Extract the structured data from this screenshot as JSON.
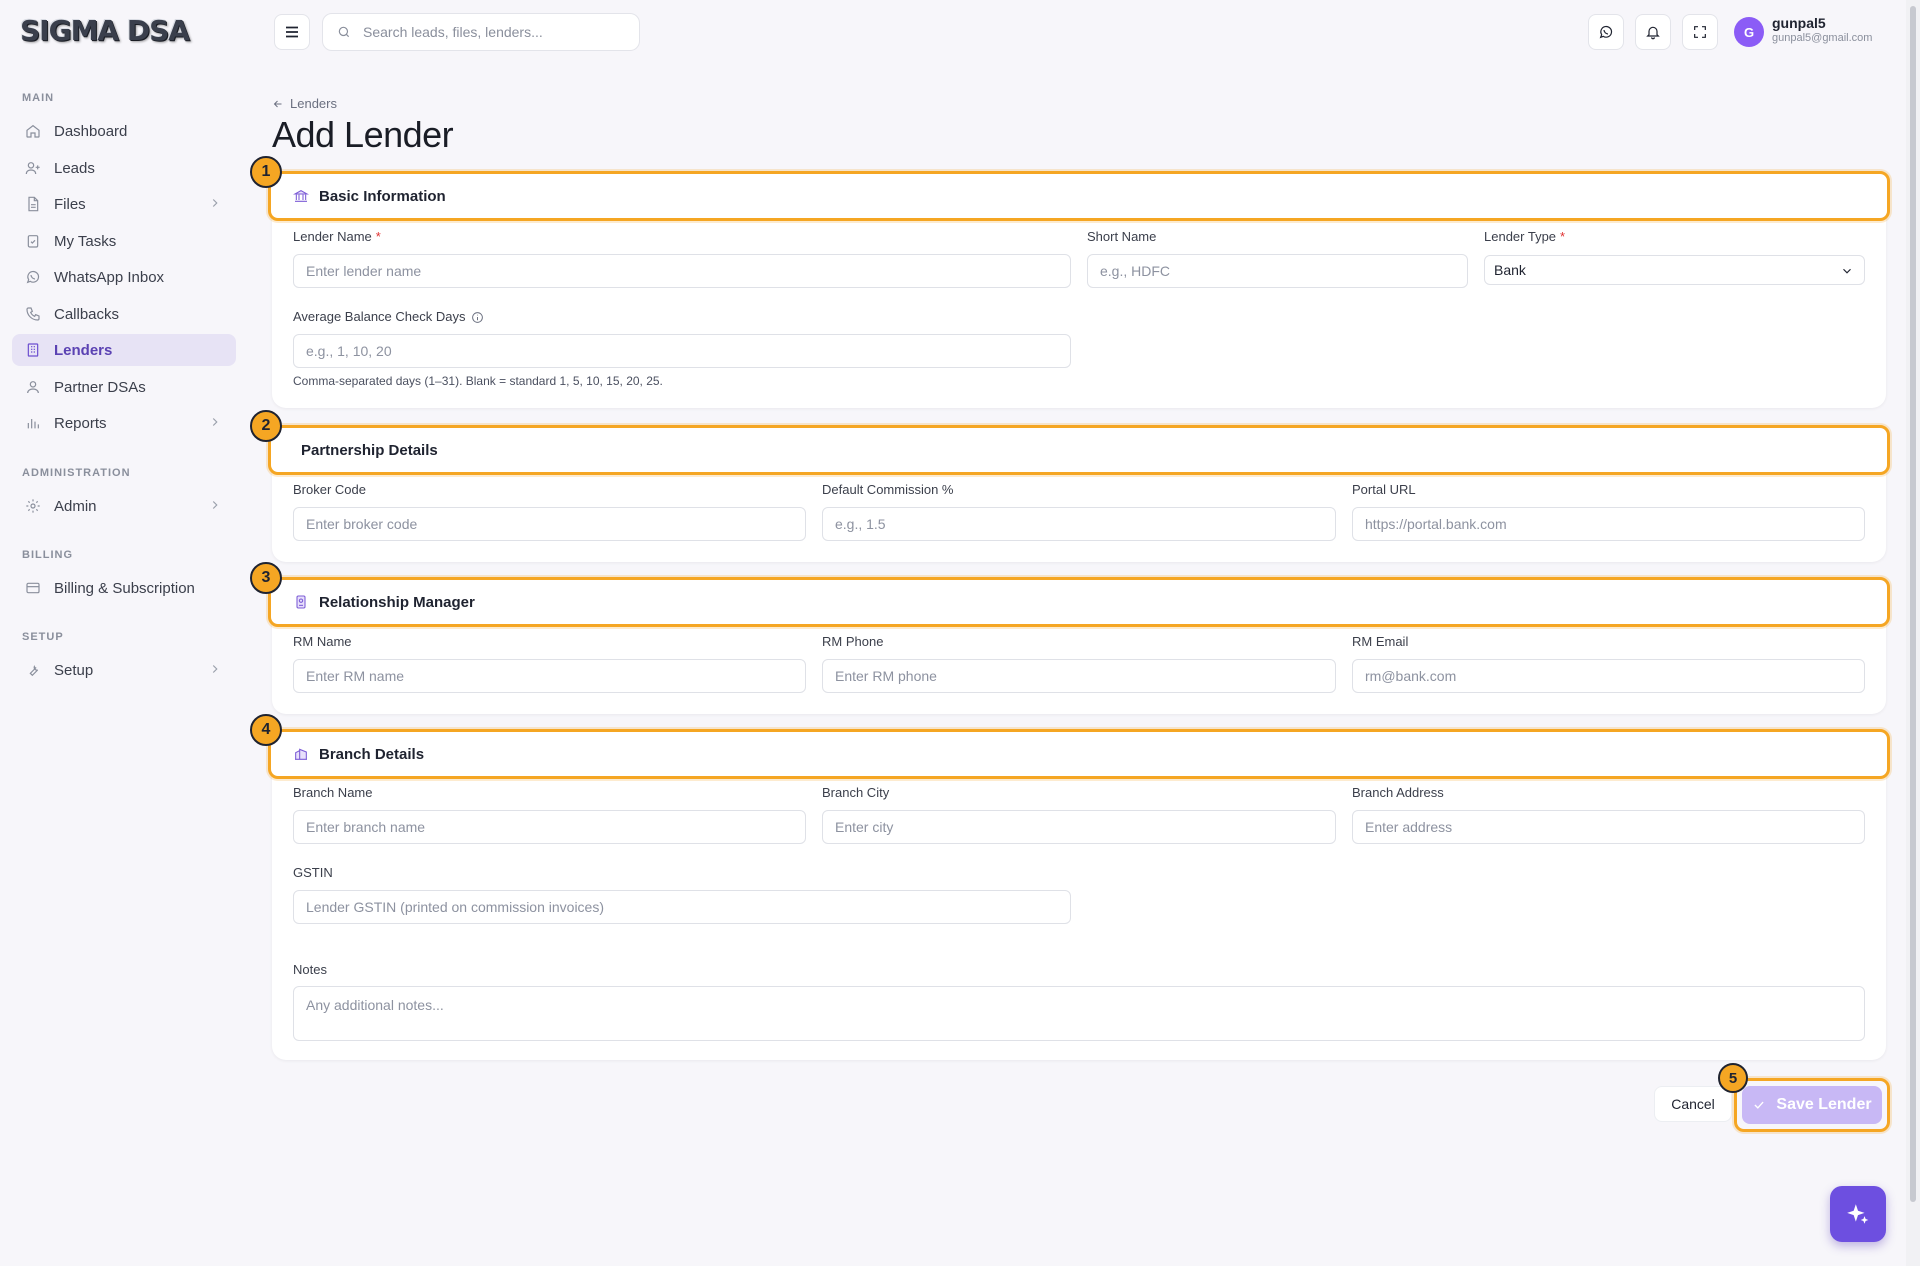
{
  "brand": {
    "logo_text": "SIGMA DSA"
  },
  "sidebar": {
    "sections": {
      "main": "MAIN",
      "administration": "ADMINISTRATION",
      "billing": "BILLING",
      "setup": "SETUP"
    },
    "items": [
      {
        "label": "Dashboard",
        "icon": "home-icon"
      },
      {
        "label": "Leads",
        "icon": "user-plus-icon"
      },
      {
        "label": "Files",
        "icon": "file-icon"
      },
      {
        "label": "My Tasks",
        "icon": "clipboard-check-icon"
      },
      {
        "label": "WhatsApp Inbox",
        "icon": "whatsapp-icon"
      },
      {
        "label": "Callbacks",
        "icon": "phone-icon"
      },
      {
        "label": "Lenders",
        "icon": "building-icon"
      },
      {
        "label": "Partner DSAs",
        "icon": "users-icon"
      },
      {
        "label": "Reports",
        "icon": "bar-chart-icon"
      },
      {
        "label": "Admin",
        "icon": "gear-icon"
      },
      {
        "label": "Billing & Subscription",
        "icon": "credit-card-icon"
      },
      {
        "label": "Setup",
        "icon": "wrench-icon"
      }
    ],
    "active_item": "Lenders"
  },
  "topbar": {
    "search_placeholder": "Search leads, files, lenders...",
    "user": {
      "initial": "G",
      "name": "gunpal5",
      "email": "gunpal5@gmail.com"
    }
  },
  "page": {
    "breadcrumb": "Lenders",
    "title": "Add Lender"
  },
  "sections": {
    "basic": {
      "number": "1",
      "title": "Basic Information",
      "lender_name_label": "Lender Name",
      "lender_name_placeholder": "Enter lender name",
      "short_name_label": "Short Name",
      "short_name_placeholder": "e.g., HDFC",
      "lender_type_label": "Lender Type",
      "lender_type_value": "Bank",
      "avg_days_label": "Average Balance Check Days",
      "avg_days_placeholder": "e.g., 1, 10, 20",
      "avg_days_hint": "Comma-separated days (1–31). Blank = standard 1, 5, 10, 15, 20, 25.",
      "required_mark": "*"
    },
    "partnership": {
      "number": "2",
      "title": "Partnership Details",
      "broker_code_label": "Broker Code",
      "broker_code_placeholder": "Enter broker code",
      "commission_label": "Default Commission %",
      "commission_placeholder": "e.g., 1.5",
      "portal_label": "Portal URL",
      "portal_placeholder": "https://portal.bank.com"
    },
    "rm": {
      "number": "3",
      "title": "Relationship Manager",
      "name_label": "RM Name",
      "name_placeholder": "Enter RM name",
      "phone_label": "RM Phone",
      "phone_placeholder": "Enter RM phone",
      "email_label": "RM Email",
      "email_placeholder": "rm@bank.com"
    },
    "branch": {
      "number": "4",
      "title": "Branch Details",
      "name_label": "Branch Name",
      "name_placeholder": "Enter branch name",
      "city_label": "Branch City",
      "city_placeholder": "Enter city",
      "address_label": "Branch Address",
      "address_placeholder": "Enter address",
      "gstin_label": "GSTIN",
      "gstin_placeholder": "Lender GSTIN (printed on commission invoices)",
      "notes_label": "Notes",
      "notes_placeholder": "Any additional notes..."
    }
  },
  "actions": {
    "cancel_label": "Cancel",
    "save_label": "Save Lender",
    "save_number": "5"
  },
  "colors": {
    "accent": "#6d4fe0",
    "highlight": "#f5a623",
    "active_nav_bg": "#e7e3f5"
  }
}
